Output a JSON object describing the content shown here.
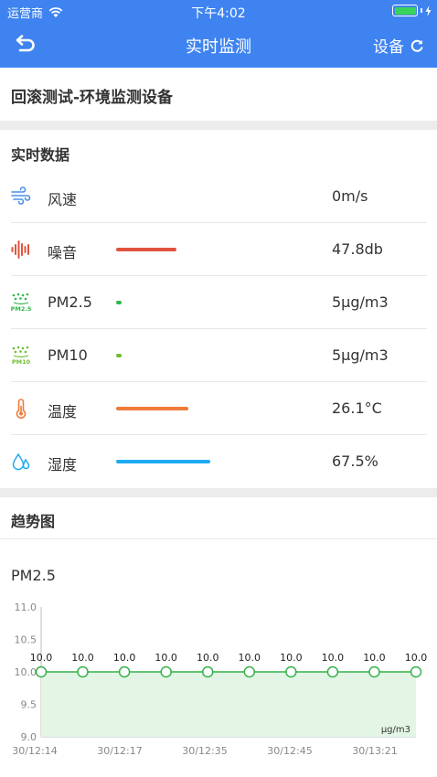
{
  "status": {
    "carrier": "运营商",
    "time": "下午4:02"
  },
  "nav": {
    "title": "实时监测",
    "device_label": "设备"
  },
  "device_name": "回滚测试-环境监测设备",
  "realtime": {
    "title": "实时数据",
    "items": [
      {
        "label": "风速",
        "value": "0m/s",
        "icon": "wind-icon",
        "level": 0,
        "bar_color": ""
      },
      {
        "label": "噪音",
        "value": "47.8db",
        "icon": "noise-icon",
        "level": 0.3,
        "bar_color": "#e0533e"
      },
      {
        "label": "PM2.5",
        "value": "5μg/m3",
        "icon": "pm25-icon",
        "level": 0.02,
        "bar_color": "#2fb84a"
      },
      {
        "label": "PM10",
        "value": "5μg/m3",
        "icon": "pm10-icon",
        "level": 0.02,
        "bar_color": "#6cbf2e"
      },
      {
        "label": "温度",
        "value": "26.1°C",
        "icon": "thermometer-icon",
        "level": 0.36,
        "bar_color": "#ef7b3a"
      },
      {
        "label": "湿度",
        "value": "67.5%",
        "icon": "humidity-icon",
        "level": 0.47,
        "bar_color": "#1eaaf1"
      }
    ]
  },
  "trend": {
    "title": "趋势图",
    "chart_title": "PM2.5"
  },
  "chart_data": {
    "type": "area",
    "title": "PM2.5",
    "unit": "μg/m3",
    "ylim": [
      9.0,
      11.0
    ],
    "yticks": [
      "11.0",
      "10.5",
      "10.0",
      "9.5",
      "9.0"
    ],
    "xticks": [
      "30/12:14",
      "30/12:17",
      "30/12:35",
      "30/12:45",
      "30/13:21"
    ],
    "values": [
      10.0,
      10.0,
      10.0,
      10.0,
      10.0,
      10.0,
      10.0,
      10.0,
      10.0,
      10.0
    ],
    "labels": [
      "10.0",
      "10.0",
      "10.0",
      "10.0",
      "10.0",
      "10.0",
      "10.0",
      "10.0",
      "10.0",
      "10.0"
    ],
    "color": "#33b24a",
    "fill": "#e3f5e5"
  }
}
